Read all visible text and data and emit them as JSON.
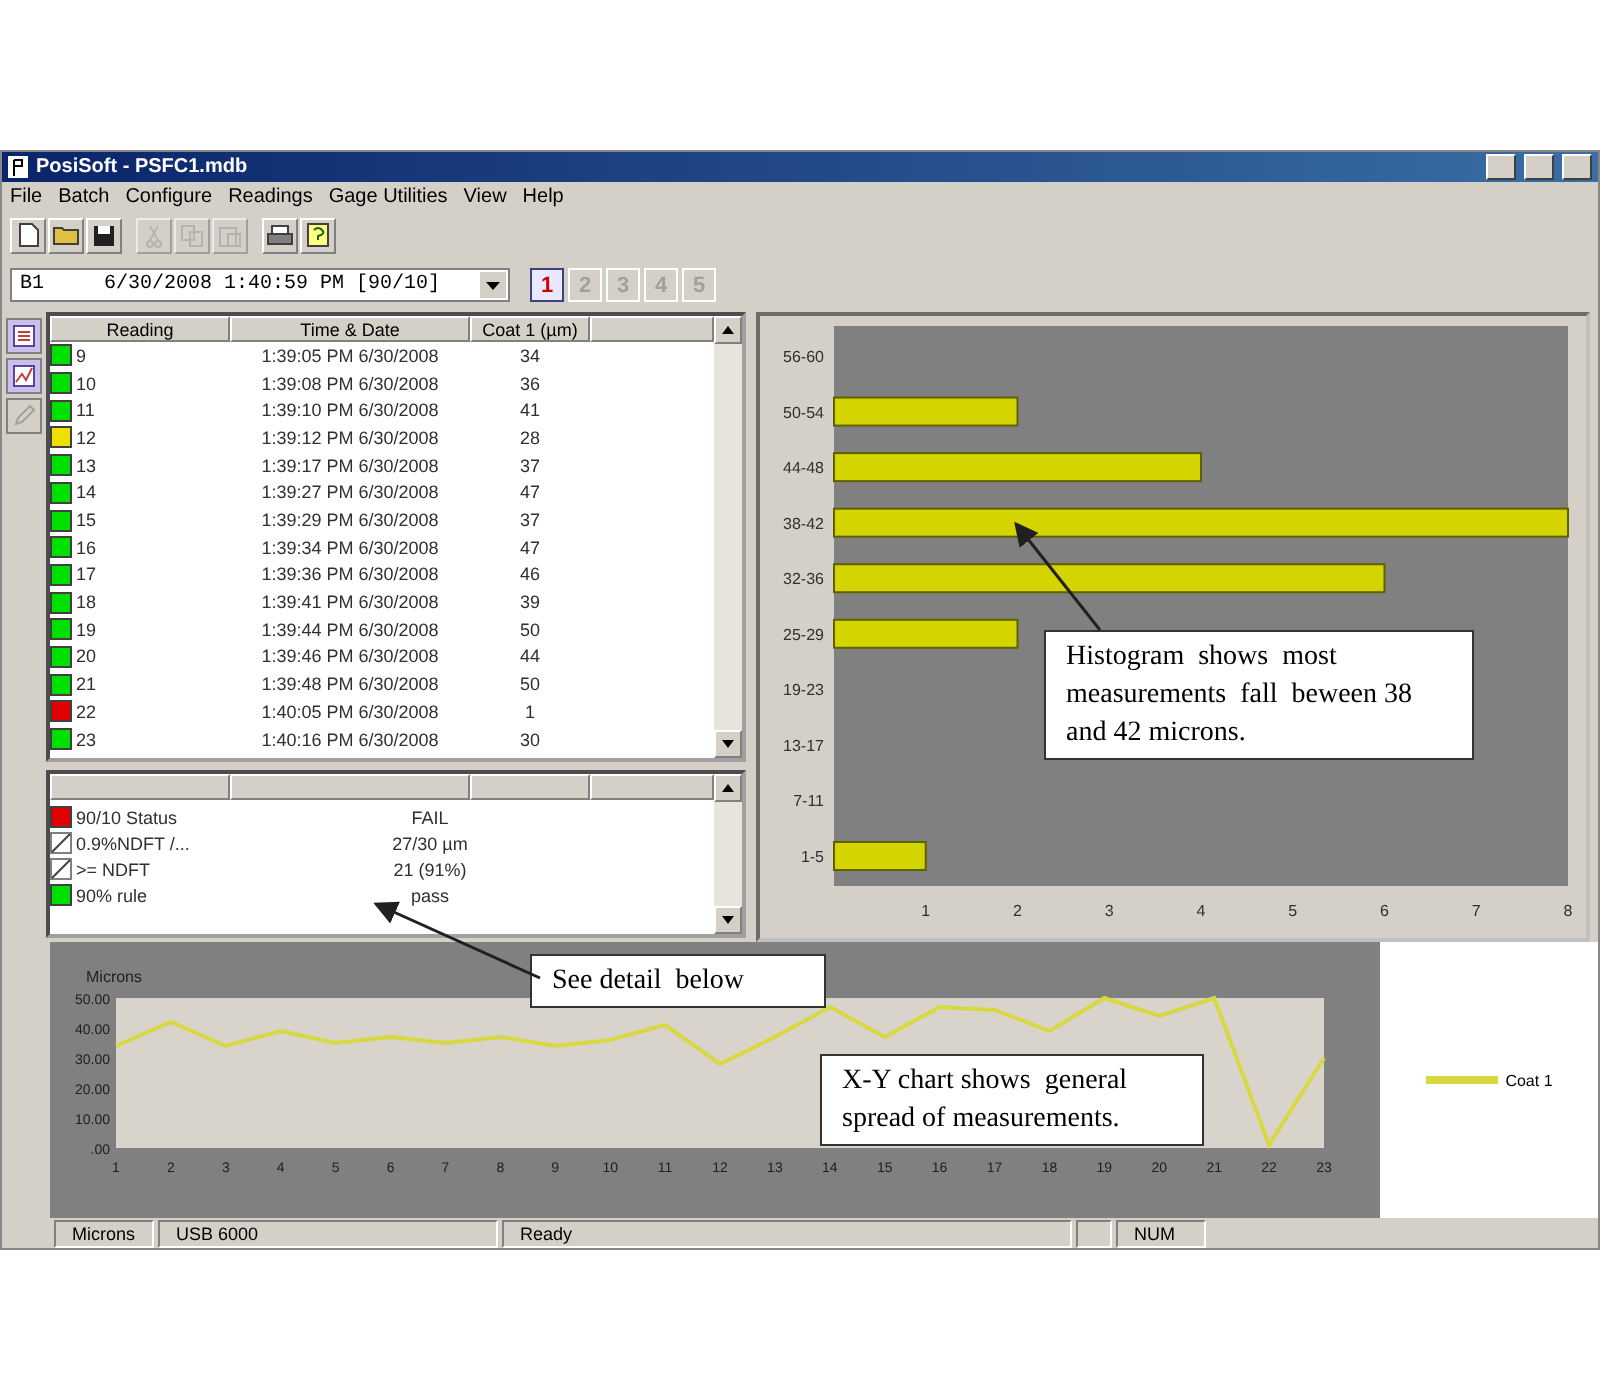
{
  "window": {
    "title": "PosiSoft - PSFC1.mdb"
  },
  "menu": [
    "File",
    "Batch",
    "Configure",
    "Readings",
    "Gage Utilities",
    "View",
    "Help"
  ],
  "toolbar": [
    {
      "kind": "new",
      "disabled": false
    },
    {
      "kind": "open",
      "disabled": false
    },
    {
      "kind": "save",
      "disabled": false
    },
    {
      "kind": "cut",
      "disabled": true
    },
    {
      "kind": "copy",
      "disabled": true
    },
    {
      "kind": "paste",
      "disabled": true
    },
    {
      "kind": "print",
      "disabled": false
    },
    {
      "kind": "help",
      "disabled": false
    }
  ],
  "batch_select": {
    "batch": "B1",
    "value": "6/30/2008 1:40:59 PM [90/10]"
  },
  "probe_tabs": [
    {
      "label": "1",
      "selected": true
    },
    {
      "label": "2",
      "selected": false
    },
    {
      "label": "3",
      "selected": false
    },
    {
      "label": "4",
      "selected": false
    },
    {
      "label": "5",
      "selected": false
    }
  ],
  "view_tools": [
    {
      "kind": "list",
      "disabled": false
    },
    {
      "kind": "chart",
      "disabled": false
    },
    {
      "kind": "edit",
      "disabled": true
    }
  ],
  "readings": {
    "columns": [
      "Reading",
      "Time & Date",
      "Coat 1 (µm)"
    ],
    "rows": [
      {
        "reading": "9",
        "time": "1:39:05 PM 6/30/2008",
        "coat": "34",
        "color": "#00e000"
      },
      {
        "reading": "10",
        "time": "1:39:08 PM 6/30/2008",
        "coat": "36",
        "color": "#00e000"
      },
      {
        "reading": "11",
        "time": "1:39:10 PM 6/30/2008",
        "coat": "41",
        "color": "#00e000"
      },
      {
        "reading": "12",
        "time": "1:39:12 PM 6/30/2008",
        "coat": "28",
        "color": "#f0e000"
      },
      {
        "reading": "13",
        "time": "1:39:17 PM 6/30/2008",
        "coat": "37",
        "color": "#00e000"
      },
      {
        "reading": "14",
        "time": "1:39:27 PM 6/30/2008",
        "coat": "47",
        "color": "#00e000"
      },
      {
        "reading": "15",
        "time": "1:39:29 PM 6/30/2008",
        "coat": "37",
        "color": "#00e000"
      },
      {
        "reading": "16",
        "time": "1:39:34 PM 6/30/2008",
        "coat": "47",
        "color": "#00e000"
      },
      {
        "reading": "17",
        "time": "1:39:36 PM 6/30/2008",
        "coat": "46",
        "color": "#00e000"
      },
      {
        "reading": "18",
        "time": "1:39:41 PM 6/30/2008",
        "coat": "39",
        "color": "#00e000"
      },
      {
        "reading": "19",
        "time": "1:39:44 PM 6/30/2008",
        "coat": "50",
        "color": "#00e000"
      },
      {
        "reading": "20",
        "time": "1:39:46 PM 6/30/2008",
        "coat": "44",
        "color": "#00e000"
      },
      {
        "reading": "21",
        "time": "1:39:48 PM 6/30/2008",
        "coat": "50",
        "color": "#00e000"
      },
      {
        "reading": "22",
        "time": "1:40:05 PM 6/30/2008",
        "coat": "1",
        "color": "#e00000"
      },
      {
        "reading": "23",
        "time": "1:40:16 PM 6/30/2008",
        "coat": "30",
        "color": "#00e000"
      }
    ]
  },
  "summary": [
    {
      "kind": "swatch",
      "color": "#e00000",
      "label": "90/10 Status",
      "value": "FAIL"
    },
    {
      "kind": "none",
      "label": "0.9%NDFT /...",
      "value": "27/30 µm"
    },
    {
      "kind": "none",
      "label": ">= NDFT",
      "value": "21 (91%)"
    },
    {
      "kind": "swatch",
      "color": "#00e000",
      "label": "90% rule",
      "value": "pass"
    }
  ],
  "histogram": {
    "chart_data": {
      "type": "bar",
      "orientation": "horizontal",
      "categories": [
        "56-60",
        "50-54",
        "44-48",
        "38-42",
        "32-36",
        "25-29",
        "19-23",
        "13-17",
        "7-11",
        "1-5"
      ],
      "series": [
        {
          "color": "#d4d400",
          "values": [
            0,
            2,
            4,
            8,
            6,
            2,
            0,
            0,
            0,
            1
          ]
        }
      ],
      "xlim": [
        0,
        8
      ],
      "xticks": [
        1,
        2,
        3,
        4,
        5,
        6,
        7,
        8
      ]
    }
  },
  "xy_chart": {
    "chart_data": {
      "type": "line",
      "ylabel": "Microns",
      "x": [
        1,
        2,
        3,
        4,
        5,
        6,
        7,
        8,
        9,
        10,
        11,
        12,
        13,
        14,
        15,
        16,
        17,
        18,
        19,
        20,
        21,
        22,
        23
      ],
      "series": [
        {
          "name": "Coat 1",
          "color": "#d8d840",
          "values": [
            34,
            42,
            34,
            39,
            35,
            37,
            35,
            37,
            34,
            36,
            41,
            28,
            37,
            47,
            37,
            47,
            46,
            39,
            50,
            44,
            50,
            1,
            30
          ]
        }
      ],
      "xlim": [
        1,
        23
      ],
      "ylim": [
        0,
        50
      ],
      "yticks": [
        {
          "value": 0,
          "label": ".00"
        },
        {
          "value": 10,
          "label": "10.00"
        },
        {
          "value": 20,
          "label": "20.00"
        },
        {
          "value": 30,
          "label": "30.00"
        },
        {
          "value": 40,
          "label": "40.00"
        },
        {
          "value": 50,
          "label": "50.00"
        }
      ],
      "xticks": [
        1,
        2,
        3,
        4,
        5,
        6,
        7,
        8,
        9,
        10,
        11,
        12,
        13,
        14,
        15,
        16,
        17,
        18,
        19,
        20,
        21,
        22,
        23
      ]
    }
  },
  "callouts": [
    {
      "kind": "detail",
      "text": "See detail  below"
    },
    {
      "kind": "histogram",
      "text": "Histogram  shows  most measurements  fall  beween 38 and 42 microns."
    },
    {
      "kind": "xy",
      "text": "X-Y chart shows  general spread of measurements."
    }
  ],
  "status_bar": [
    "Microns",
    "USB 6000",
    "Ready",
    "NUM"
  ]
}
